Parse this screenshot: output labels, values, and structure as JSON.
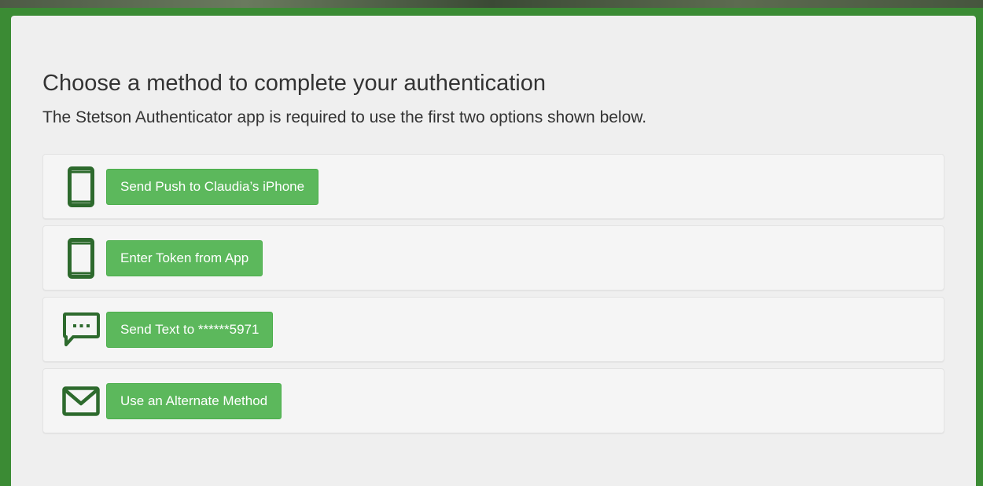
{
  "auth": {
    "heading": "Choose a method to complete your authentication",
    "subheading": "The Stetson Authenticator app is required to use the first two options shown below."
  },
  "options": [
    {
      "icon": "smartphone-icon",
      "label": "Send Push to Claudia’s iPhone"
    },
    {
      "icon": "smartphone-icon",
      "label": "Enter Token from App"
    },
    {
      "icon": "chat-bubble-icon",
      "label": "Send Text to ******5971"
    },
    {
      "icon": "envelope-icon",
      "label": "Use an Alternate Method"
    }
  ],
  "colors": {
    "accent_green": "#5cb85c",
    "icon_green": "#2d6a2d",
    "frame_green": "#3b8b34",
    "panel_bg": "#efefef"
  }
}
